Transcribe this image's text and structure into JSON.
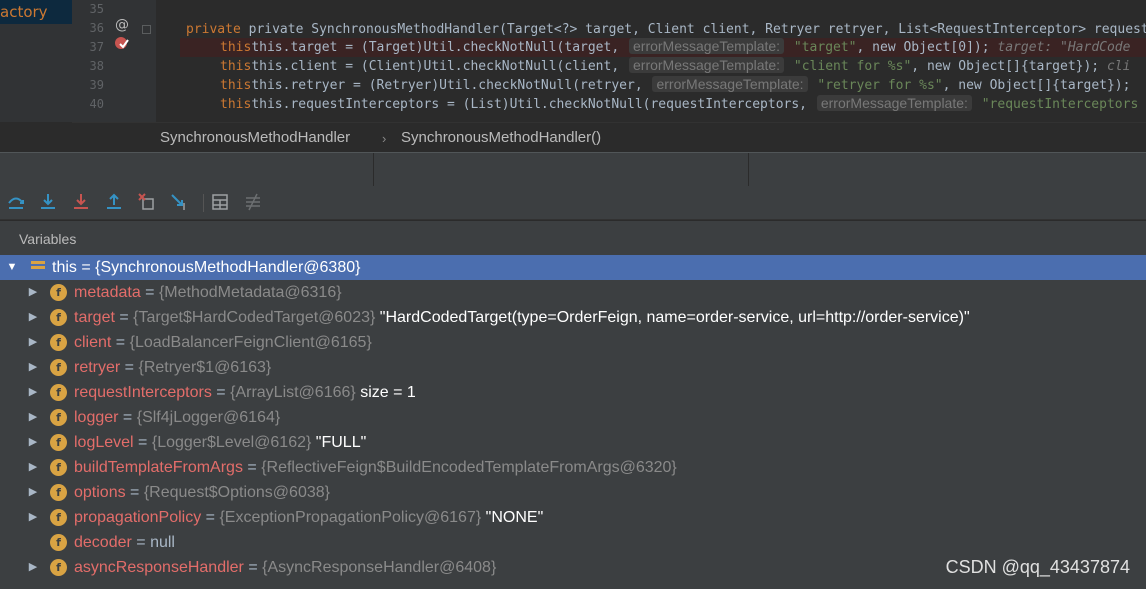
{
  "editor": {
    "left_item": "actory",
    "line_numbers": [
      "35",
      "36",
      "37",
      "38",
      "39",
      "40"
    ],
    "lines": [
      {
        "pre": "private SynchronousMethodHandler(Target<?> target, Client client, Retryer retryer, List<RequestInterceptor> requestInter"
      },
      {
        "pre": "this.target = (Target)Util.checkNotNull(target, ",
        "hint": "errorMessageTemplate:",
        "str": " \"target\"",
        "post": ", new Object[0]);",
        "inline": "  target: \"HardCode"
      },
      {
        "pre": "this.client = (Client)Util.checkNotNull(client, ",
        "hint": "errorMessageTemplate:",
        "str": " \"client for %s\"",
        "post": ", new Object[]{target});",
        "inline": "  cli"
      },
      {
        "pre": "this.retryer = (Retryer)Util.checkNotNull(retryer, ",
        "hint": "errorMessageTemplate:",
        "str": " \"retryer for %s\"",
        "post": ", new Object[]{target});"
      },
      {
        "pre": "this.requestInterceptors = (List)Util.checkNotNull(requestInterceptors, ",
        "hint": "errorMessageTemplate:",
        "str": " \"requestInterceptors"
      }
    ]
  },
  "breadcrumb": {
    "class": "SynchronousMethodHandler",
    "method": "SynchronousMethodHandler()"
  },
  "panel": {
    "title": "Variables"
  },
  "variables": {
    "root": {
      "name": "this",
      "value": " = {SynchronousMethodHandler@6380}"
    },
    "fields": [
      {
        "name": "metadata",
        "ref": "{MethodMetadata@6316}",
        "extra": ""
      },
      {
        "name": "target",
        "ref": "{Target$HardCodedTarget@6023}",
        "extra": "\"HardCodedTarget(type=OrderFeign, name=order-service, url=http://order-service)\""
      },
      {
        "name": "client",
        "ref": "{LoadBalancerFeignClient@6165}",
        "extra": ""
      },
      {
        "name": "retryer",
        "ref": "{Retryer$1@6163}",
        "extra": ""
      },
      {
        "name": "requestInterceptors",
        "ref": "{ArrayList@6166}",
        "extra": " size = 1"
      },
      {
        "name": "logger",
        "ref": "{Slf4jLogger@6164}",
        "extra": ""
      },
      {
        "name": "logLevel",
        "ref": "{Logger$Level@6162}",
        "extra": "\"FULL\""
      },
      {
        "name": "buildTemplateFromArgs",
        "ref": "{ReflectiveFeign$BuildEncodedTemplateFromArgs@6320}",
        "extra": ""
      },
      {
        "name": "options",
        "ref": "{Request$Options@6038}",
        "extra": ""
      },
      {
        "name": "propagationPolicy",
        "ref": "{ExceptionPropagationPolicy@6167}",
        "extra": "\"NONE\""
      },
      {
        "name": "decoder",
        "ref": "",
        "extra": "null"
      },
      {
        "name": "asyncResponseHandler",
        "ref": "{AsyncResponseHandler@6408}",
        "extra": ""
      }
    ]
  },
  "watermark": "CSDN @qq_43437874",
  "colors": {
    "selection": "#4b6eaf",
    "field_name": "#e36d6a",
    "keyword": "#cc7832",
    "string": "#6a8759"
  }
}
